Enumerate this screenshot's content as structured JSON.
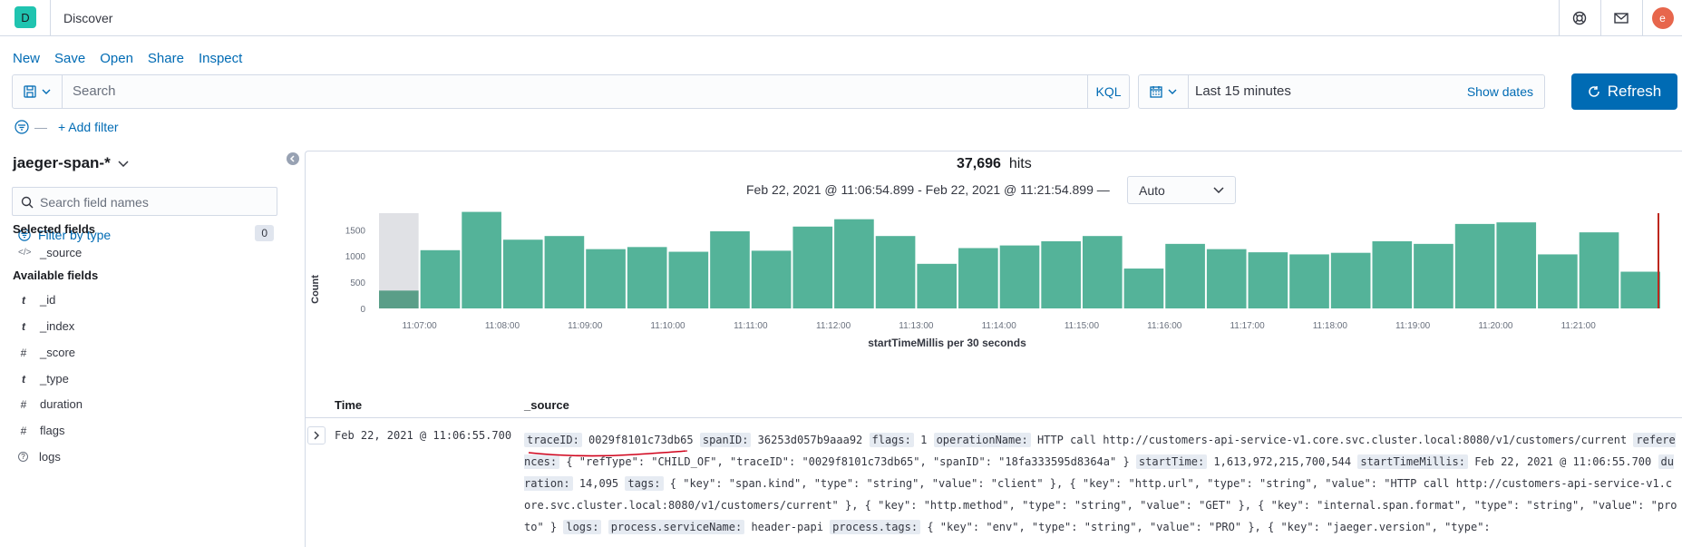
{
  "header": {
    "logo_letter": "D",
    "app_title": "Discover",
    "avatar_letter": "e",
    "icons": [
      "help-icon",
      "mail-icon"
    ]
  },
  "menu": [
    "New",
    "Save",
    "Open",
    "Share",
    "Inspect"
  ],
  "query": {
    "placeholder": "Search",
    "language": "KQL"
  },
  "time": {
    "range": "Last 15 minutes",
    "show_dates": "Show dates"
  },
  "refresh_label": "Refresh",
  "add_filter": "+ Add filter",
  "sidebar": {
    "index_pattern": "jaeger-span-*",
    "search_placeholder": "Search field names",
    "filter_by_type": "Filter by type",
    "filter_count": "0",
    "selected_heading": "Selected fields",
    "selected_fields": [
      {
        "type": "</>",
        "name": "_source"
      }
    ],
    "available_heading": "Available fields",
    "available_fields": [
      {
        "type": "t",
        "name": "_id"
      },
      {
        "type": "t",
        "name": "_index"
      },
      {
        "type": "#",
        "name": "_score"
      },
      {
        "type": "t",
        "name": "_type"
      },
      {
        "type": "#",
        "name": "duration"
      },
      {
        "type": "#",
        "name": "flags"
      },
      {
        "type": "?",
        "name": "logs"
      }
    ]
  },
  "hits": {
    "count": "37,696",
    "label": "hits"
  },
  "date_range": "Feb 22, 2021 @ 11:06:54.899 - Feb 22, 2021 @ 11:21:54.899 —",
  "interval": "Auto",
  "chart_data": {
    "type": "bar",
    "xlabel": "startTimeMillis per 30 seconds",
    "ylabel": "Count",
    "ylim": [
      0,
      1850
    ],
    "yticks": [
      0,
      500,
      1000,
      1500
    ],
    "xticks": [
      "11:07:00",
      "11:08:00",
      "11:09:00",
      "11:10:00",
      "11:11:00",
      "11:12:00",
      "11:13:00",
      "11:14:00",
      "11:15:00",
      "11:16:00",
      "11:17:00",
      "11:18:00",
      "11:19:00",
      "11:20:00",
      "11:21:00"
    ],
    "bar_color": "#54b399",
    "values": [
      340,
      1110,
      1840,
      1310,
      1380,
      1130,
      1170,
      1080,
      1470,
      1100,
      1560,
      1700,
      1380,
      850,
      1150,
      1200,
      1280,
      1380,
      760,
      1230,
      1130,
      1070,
      1030,
      1060,
      1280,
      1230,
      1610,
      1640,
      1030,
      1450,
      700
    ],
    "grey_first_bar": true,
    "now_marker": true
  },
  "table": {
    "col_time": "Time",
    "col_source": "_source",
    "row": {
      "time": "Feb 22, 2021 @ 11:06:55.700",
      "fields": [
        {
          "k": "traceID:",
          "v": "0029f8101c73db65"
        },
        {
          "k": "spanID:",
          "v": "36253d057b9aaa92"
        },
        {
          "k": "flags:",
          "v": "1"
        },
        {
          "k": "operationName:",
          "v": "HTTP call http://customers-api-service-v1.core.svc.cluster.local:8080/v1/customers/current"
        },
        {
          "k": "references:",
          "v": "{ \"refType\": \"CHILD_OF\", \"traceID\": \"0029f8101c73db65\", \"spanID\": \"18fa333595d8364a\" }"
        },
        {
          "k": "startTime:",
          "v": "1,613,972,215,700,544"
        },
        {
          "k": "startTimeMillis:",
          "v": "Feb 22, 2021 @ 11:06:55.700"
        },
        {
          "k": "duration:",
          "v": "14,095"
        },
        {
          "k": "tags:",
          "v": "{ \"key\": \"span.kind\", \"type\": \"string\", \"value\": \"client\" }, { \"key\": \"http.url\", \"type\": \"string\", \"value\": \"HTTP call http://customers-api-service-v1.core.svc.cluster.local:8080/v1/customers/current\" }, { \"key\": \"http.method\", \"type\": \"string\", \"value\": \"GET\" }, { \"key\": \"internal.span.format\", \"type\": \"string\", \"value\": \"proto\" }"
        },
        {
          "k": "logs:",
          "v": ""
        },
        {
          "k": "process.serviceName:",
          "v": "header-papi"
        },
        {
          "k": "process.tags:",
          "v": "{ \"key\": \"env\", \"type\": \"string\", \"value\": \"PRO\" }, { \"key\": \"jaeger.version\", \"type\":"
        }
      ]
    }
  }
}
